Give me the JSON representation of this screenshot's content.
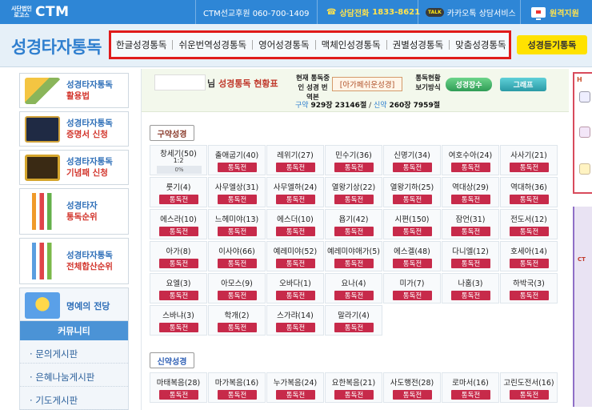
{
  "topbar": {
    "logo_small": "사단법인 로고스",
    "logo_big": "CTM",
    "sponsor": "CTM선교후원 060-700-1409",
    "consult_label": "상담전화",
    "consult_number": "1833-8621",
    "kakao_badge": "TALK",
    "kakao": "카카오톡 상담서비스",
    "remote": "원격지원"
  },
  "nav": {
    "brand": "성경타자통독",
    "menu": [
      "한글성경통독",
      "쉬운번역성경통독",
      "영어성경통독",
      "맥체인성경통독",
      "권별성경통독",
      "맞춤성경통독"
    ],
    "listen_button": "성경듣기통독"
  },
  "sidebar": {
    "items": [
      {
        "line1": "성경타자통독",
        "line2": "활용법"
      },
      {
        "line1": "성경타자통독",
        "line2": "증명서 신청"
      },
      {
        "line1": "성경타자통독",
        "line2": "기념패 신청"
      },
      {
        "line1": "성경타자",
        "line2": "통독순위"
      },
      {
        "line1": "성경타자통독",
        "line2": "전체합산순위"
      }
    ],
    "fame": "명예의 전당",
    "community_title": "커뮤니티",
    "community_links": [
      "문의게시판",
      "은혜나눔게시판",
      "기도게시판"
    ]
  },
  "status": {
    "title_prefix": "님",
    "title": "성경통독 현황표",
    "current_label": "현재 통독중인 성경 번역본",
    "current_value": "[아가페쉬운성경]",
    "view_label": "통독현황 보기방식",
    "btn_chapters": "성경장수",
    "btn_graph": "그래프",
    "ot_label": "구약",
    "ot_counts": "929장 23146절",
    "nt_label": "신약",
    "nt_counts": "260장 7959절"
  },
  "ot_section": "구약성경",
  "nt_section": "신약성경",
  "read_button": "통독전",
  "ot_books": [
    {
      "name": "창세기(50)",
      "ratio": "1:2",
      "progress": "0%"
    },
    {
      "name": "출애굽기(40)"
    },
    {
      "name": "레위기(27)"
    },
    {
      "name": "민수기(36)"
    },
    {
      "name": "신명기(34)"
    },
    {
      "name": "여호수아(24)"
    },
    {
      "name": "사사기(21)"
    },
    {
      "name": "룻기(4)"
    },
    {
      "name": "사무엘상(31)"
    },
    {
      "name": "사무엘하(24)"
    },
    {
      "name": "열왕기상(22)"
    },
    {
      "name": "열왕기하(25)"
    },
    {
      "name": "역대상(29)"
    },
    {
      "name": "역대하(36)"
    },
    {
      "name": "에스라(10)"
    },
    {
      "name": "느헤미야(13)"
    },
    {
      "name": "에스더(10)"
    },
    {
      "name": "욥기(42)"
    },
    {
      "name": "시편(150)"
    },
    {
      "name": "잠언(31)"
    },
    {
      "name": "전도서(12)"
    },
    {
      "name": "아가(8)"
    },
    {
      "name": "이사야(66)"
    },
    {
      "name": "예레미야(52)"
    },
    {
      "name": "예레미야애가(5)"
    },
    {
      "name": "에스겔(48)"
    },
    {
      "name": "다니엘(12)"
    },
    {
      "name": "호세아(14)"
    },
    {
      "name": "요엘(3)"
    },
    {
      "name": "아모스(9)"
    },
    {
      "name": "오바다(1)"
    },
    {
      "name": "요나(4)"
    },
    {
      "name": "미가(7)"
    },
    {
      "name": "나훔(3)"
    },
    {
      "name": "하박국(3)"
    },
    {
      "name": "스바냐(3)"
    },
    {
      "name": "학개(2)"
    },
    {
      "name": "스가랴(14)"
    },
    {
      "name": "말라기(4)"
    }
  ],
  "nt_books": [
    {
      "name": "마태복음(28)"
    },
    {
      "name": "마가복음(16)"
    },
    {
      "name": "누가복음(24)"
    },
    {
      "name": "요한복음(21)"
    },
    {
      "name": "사도행전(28)"
    },
    {
      "name": "로마서(16)"
    },
    {
      "name": "고린도전서(16)"
    }
  ],
  "colors": {
    "topbar": "#2e86d6",
    "highlight_border": "#e01b1b",
    "read_button": "#c72a4a",
    "listen_button": "#ffe200"
  }
}
